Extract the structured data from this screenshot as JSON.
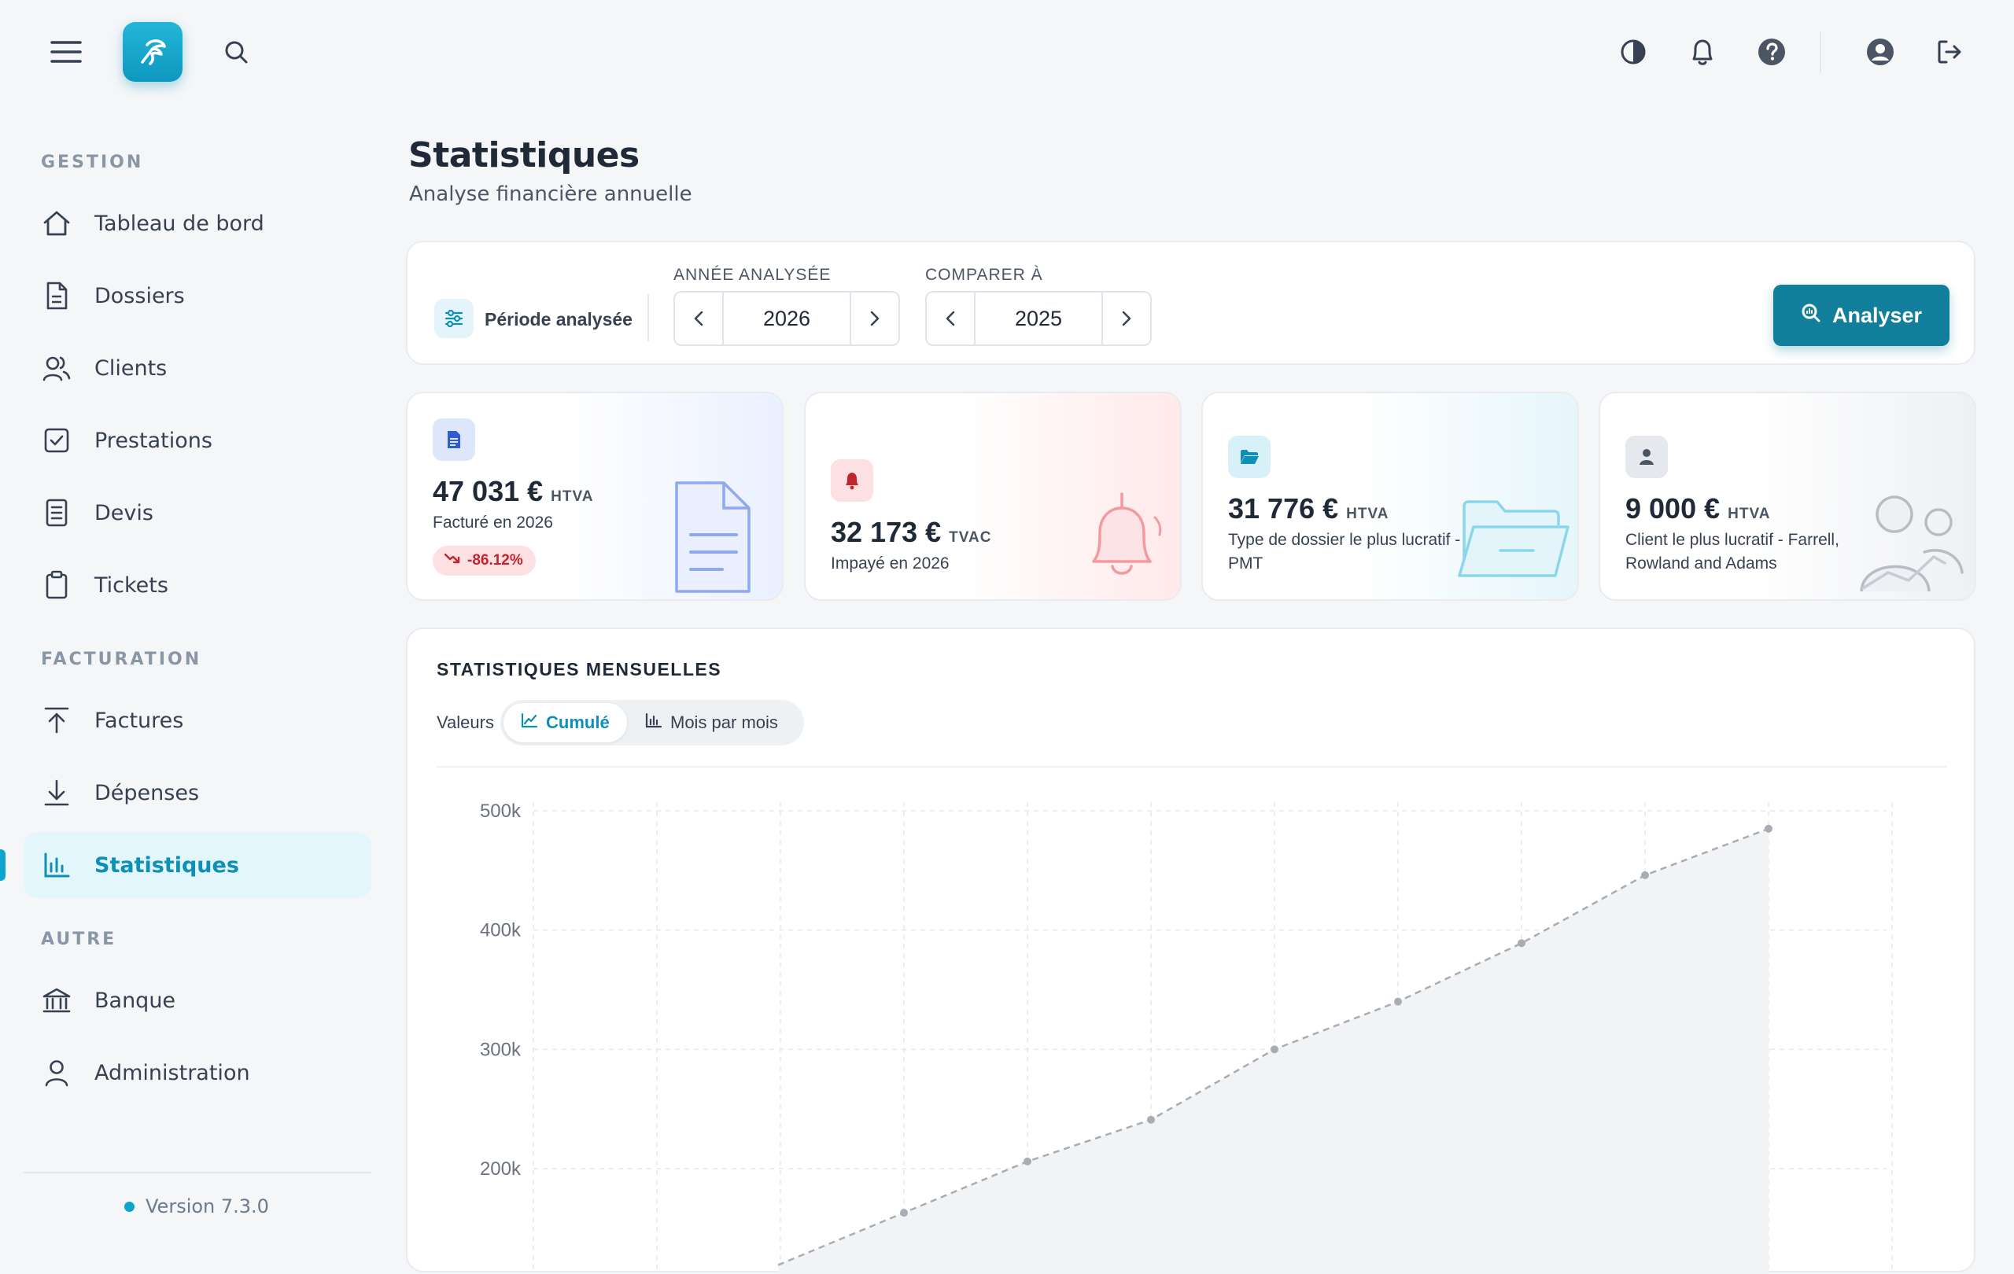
{
  "topbar": {
    "icons": [
      "menu-icon",
      "logo-icon",
      "search-icon",
      "contrast-icon",
      "bell-icon",
      "help-icon",
      "account-icon",
      "logout-icon"
    ]
  },
  "sidebar": {
    "sections": [
      {
        "title": "GESTION",
        "items": [
          "Tableau de bord",
          "Dossiers",
          "Clients",
          "Prestations",
          "Devis",
          "Tickets"
        ]
      },
      {
        "title": "FACTURATION",
        "items": [
          "Factures",
          "Dépenses",
          "Statistiques"
        ]
      },
      {
        "title": "AUTRE",
        "items": [
          "Banque",
          "Administration"
        ]
      }
    ],
    "active_item": "Statistiques",
    "version": "Version 7.3.0"
  },
  "page": {
    "title": "Statistiques",
    "subtitle": "Analyse financière annuelle"
  },
  "period": {
    "label": "Période analysée",
    "year_label": "ANNÉE ANALYSÉE",
    "year_value": "2026",
    "compare_label": "COMPARER À",
    "compare_value": "2025",
    "analyze_label": "Analyser"
  },
  "kpis": [
    {
      "value": "47 031 €",
      "unit": "HTVA",
      "desc": "Facturé en 2026",
      "badge": "-86.12%",
      "accent": "#2f5bd3"
    },
    {
      "value": "32 173 €",
      "unit": "TVAC",
      "desc": "Impayé en 2026",
      "accent": "#c0262d"
    },
    {
      "value": "31 776 €",
      "unit": "HTVA",
      "desc": "Type de dossier le plus lucratif - PMT",
      "accent": "#0e8fb5"
    },
    {
      "value": "9 000 €",
      "unit": "HTVA",
      "desc": "Client le plus lucratif - Farrell, Rowland and Adams",
      "accent": "#4b5563"
    }
  ],
  "chart_section": {
    "title": "STATISTIQUES MENSUELLES",
    "values_label": "Valeurs",
    "toggle_cumule": "Cumulé",
    "toggle_monthly": "Mois par mois"
  },
  "chart_data": {
    "type": "line",
    "ylim": [
      100000,
      520000
    ],
    "y_ticks": [
      200000,
      300000,
      400000,
      500000
    ],
    "y_tick_labels": [
      "200k",
      "300k",
      "400k",
      "500k"
    ],
    "x_count": 12,
    "series": [
      {
        "values": [
          null,
          null,
          null,
          163000,
          206000,
          241000,
          300000,
          340000,
          389000,
          446000,
          485000
        ]
      }
    ],
    "colors": {
      "line": "#a8adb4",
      "grid": "#e6e9ed",
      "fill": "#f2f3f5"
    }
  }
}
